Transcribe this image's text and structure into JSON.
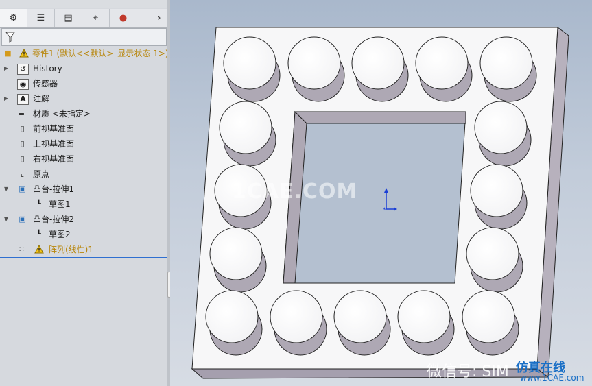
{
  "tabs": [
    {
      "name": "feature-manager",
      "glyph": "⚙"
    },
    {
      "name": "property-manager",
      "glyph": "☰"
    },
    {
      "name": "configuration-manager",
      "glyph": "▤"
    },
    {
      "name": "dimxpert",
      "glyph": "⌖"
    },
    {
      "name": "display-manager",
      "glyph": "●"
    }
  ],
  "tabs_more": "›",
  "tree": {
    "root": "零件1 (默认<<默认>_显示状态 1>)",
    "items": [
      {
        "label": "History",
        "arrow": "▶"
      },
      {
        "label": "传感器",
        "arrow": ""
      },
      {
        "label": "注解",
        "arrow": "▶"
      },
      {
        "label": "材质 <未指定>",
        "arrow": ""
      },
      {
        "label": "前视基准面",
        "arrow": ""
      },
      {
        "label": "上视基准面",
        "arrow": ""
      },
      {
        "label": "右视基准面",
        "arrow": ""
      },
      {
        "label": "原点",
        "arrow": ""
      },
      {
        "label": "凸台-拉伸1",
        "arrow": "▼"
      },
      {
        "label": "草图1",
        "arrow": ""
      },
      {
        "label": "凸台-拉伸2",
        "arrow": "▼"
      },
      {
        "label": "草图2",
        "arrow": ""
      },
      {
        "label": "阵列(线性)1",
        "arrow": ""
      }
    ]
  },
  "watermarks": {
    "center": "1CAE.COM",
    "wechat": "微信号: SIM",
    "brand": "仿真在线",
    "site": "www.1CAE.com"
  },
  "colors": {
    "warning": "#b8860b",
    "selection": "#2f6fd0",
    "cylinder_side": "#aea8b4",
    "plate_side": "#b7b1bd"
  }
}
